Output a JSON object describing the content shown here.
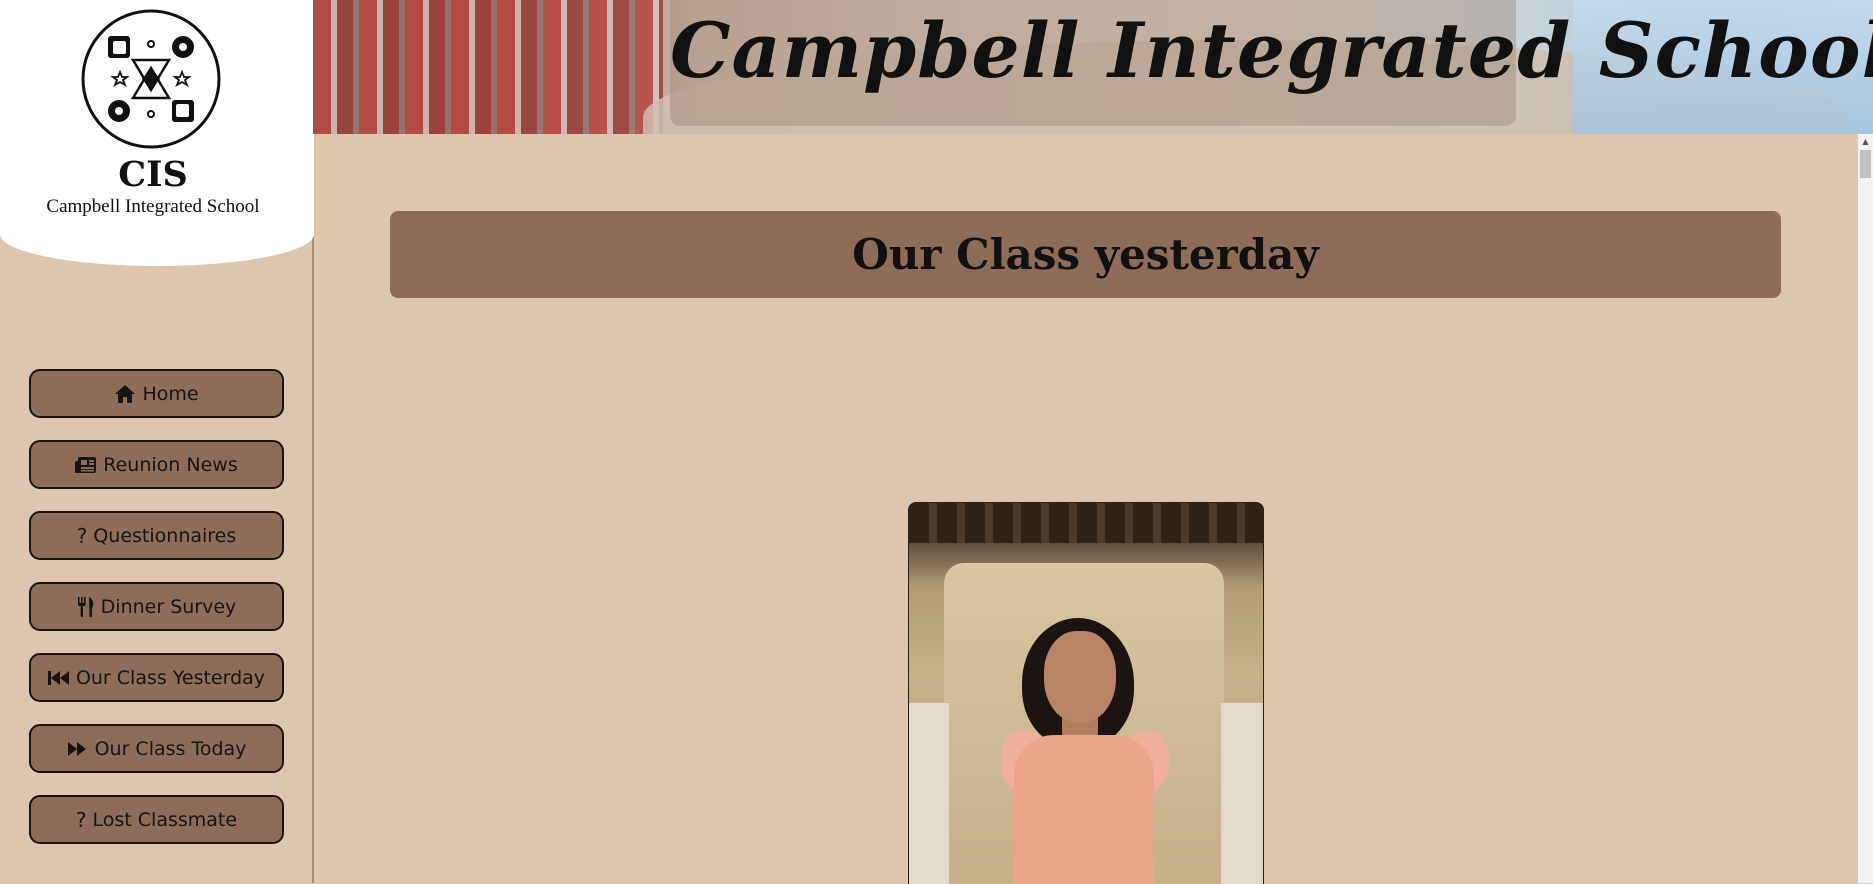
{
  "sidebar": {
    "logo": {
      "abbr": "CIS",
      "name": "Campbell Integrated School"
    },
    "nav": [
      {
        "label": "Home",
        "icon": "home-icon"
      },
      {
        "label": "Reunion News",
        "icon": "newspaper-icon"
      },
      {
        "label": "Questionnaires",
        "icon": "question-icon"
      },
      {
        "label": "Dinner Survey",
        "icon": "utensils-icon"
      },
      {
        "label": "Our Class Yesterday",
        "icon": "backward-icon"
      },
      {
        "label": "Our Class Today",
        "icon": "forward-icon"
      },
      {
        "label": "Lost Classmate",
        "icon": "question-icon"
      }
    ]
  },
  "header": {
    "title": "Campbell Integrated School"
  },
  "main": {
    "heading": "Our Class yesterday",
    "photo": "classmate-portrait"
  },
  "colors": {
    "page_bg": "#dfc5ad",
    "button_bg": "#8e6c58",
    "heading_bg": "#8e6c58"
  }
}
